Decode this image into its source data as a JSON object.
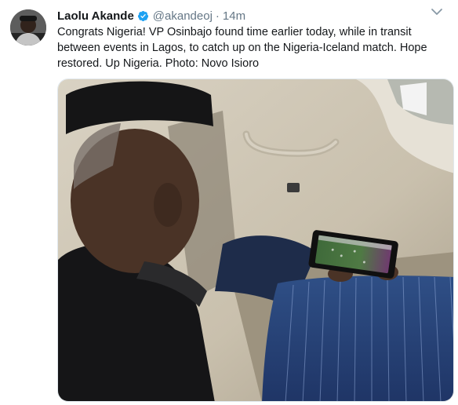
{
  "tweet": {
    "author_name": "Laolu Akande",
    "handle": "@akandeoj",
    "separator": "·",
    "time": "14m",
    "text": "Congrats Nigeria! VP Osinbajo found time earlier today, while in transit between events in Lagos, to catch up on the Nigeria-Iceland match. Hope restored. Up Nigeria. Photo: Novo Isioro",
    "verified": true,
    "verified_color": "#1da1f2",
    "icons": {
      "verified": "verified-badge-icon",
      "menu": "chevron-down-icon"
    }
  },
  "photo": {
    "subject": "man-watching-football-on-phone-in-car"
  },
  "colors": {
    "name": "#14171a",
    "meta": "#657786",
    "caret": "#8899a6"
  }
}
